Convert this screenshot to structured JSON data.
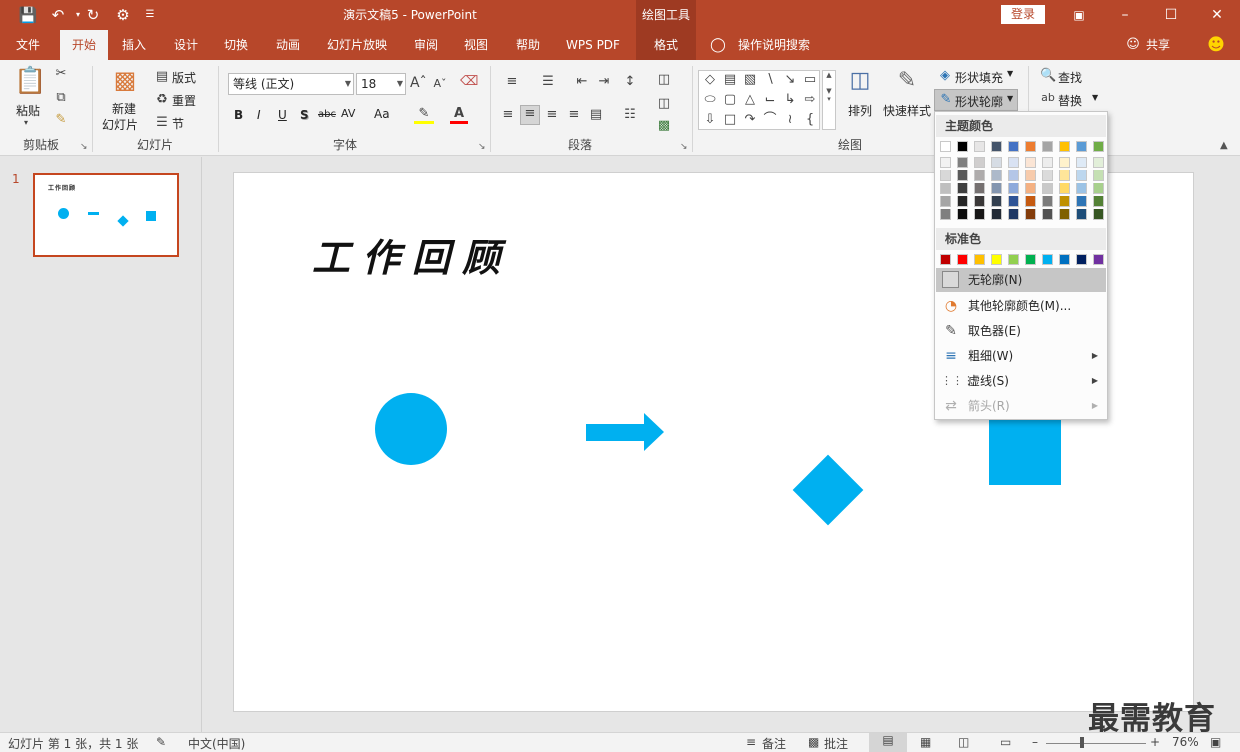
{
  "window": {
    "doc_title": "演示文稿5 - PowerPoint",
    "context_tool": "绘图工具",
    "login_label": "登录",
    "qat": {
      "save": "save-icon",
      "undo": "undo-icon",
      "redo": "redo-icon",
      "present": "present-icon",
      "customize": "customize-icon"
    }
  },
  "tabs": {
    "file": "文件",
    "home": "开始",
    "insert": "插入",
    "design": "设计",
    "transitions": "切换",
    "animations": "动画",
    "slideshow": "幻灯片放映",
    "review": "审阅",
    "view": "视图",
    "help": "帮助",
    "wps_pdf": "WPS PDF",
    "format": "格式",
    "tell_me": "操作说明搜索",
    "share": "共享"
  },
  "ribbon": {
    "clipboard": {
      "label": "剪贴板",
      "paste": "粘贴"
    },
    "slides": {
      "label": "幻灯片",
      "new_slide_l1": "新建",
      "new_slide_l2": "幻灯片",
      "layout": "版式",
      "reset": "重置",
      "section": "节"
    },
    "font": {
      "label": "字体",
      "font_name": "等线 (正文)",
      "font_size": "18",
      "bold": "B",
      "italic": "I",
      "underline": "U",
      "shadow": "S",
      "strike": "abc",
      "spacing": "AV",
      "case": "Aa"
    },
    "paragraph": {
      "label": "段落"
    },
    "drawing": {
      "label": "绘图",
      "arrange": "排列",
      "quick_styles": "快速样式",
      "shape_fill": "形状填充",
      "shape_outline": "形状轮廓"
    },
    "editing": {
      "find": "查找",
      "replace": "替换"
    }
  },
  "slides_panel": {
    "slide_number": "1",
    "thumb_title": "工作回顾"
  },
  "slide": {
    "title": "工作回顾",
    "shape_color": "#00B0F0"
  },
  "outline_menu": {
    "theme_colors_label": "主题颜色",
    "standard_colors_label": "标准色",
    "no_outline": "无轮廓(N)",
    "more_colors": "其他轮廓颜色(M)...",
    "eyedropper": "取色器(E)",
    "weight": "粗细(W)",
    "dashes": "虚线(S)",
    "arrows": "箭头(R)",
    "theme_top_row": [
      "#FFFFFF",
      "#000000",
      "#E7E6E6",
      "#44546A",
      "#4472C4",
      "#ED7D31",
      "#A5A5A5",
      "#FFC000",
      "#5B9BD5",
      "#70AD47"
    ],
    "theme_shades": [
      [
        "#F2F2F2",
        "#7F7F7F",
        "#D0CECE",
        "#D6DCE4",
        "#D9E2F3",
        "#FBE5D5",
        "#EDEDED",
        "#FFF2CC",
        "#DEEAF6",
        "#E2EFD9"
      ],
      [
        "#D8D8D8",
        "#595959",
        "#AEABAB",
        "#ADB9CA",
        "#B4C6E7",
        "#F7CBAC",
        "#DBDBDB",
        "#FFE599",
        "#BDD7EE",
        "#C5E0B3"
      ],
      [
        "#BFBFBF",
        "#3F3F3F",
        "#757070",
        "#8496B0",
        "#8EAADB",
        "#F4B183",
        "#C9C9C9",
        "#FFD965",
        "#9CC3E5",
        "#A8D08D"
      ],
      [
        "#A5A5A5",
        "#262626",
        "#3A3838",
        "#323F4F",
        "#2F5496",
        "#C55A11",
        "#7B7B7B",
        "#BF9000",
        "#2E75B5",
        "#538135"
      ],
      [
        "#7F7F7F",
        "#0C0C0C",
        "#171616",
        "#222A35",
        "#1F3864",
        "#833C0B",
        "#525252",
        "#7F6000",
        "#1E4E79",
        "#375623"
      ]
    ],
    "standard_colors": [
      "#C00000",
      "#FF0000",
      "#FFC000",
      "#FFFF00",
      "#92D050",
      "#00B050",
      "#00B0F0",
      "#0070C0",
      "#002060",
      "#7030A0"
    ]
  },
  "status": {
    "slide_info": "幻灯片 第 1 张，共 1 张",
    "language": "中文(中国)",
    "notes": "备注",
    "comments": "批注",
    "zoom": "76%"
  },
  "watermark": "最需教育"
}
